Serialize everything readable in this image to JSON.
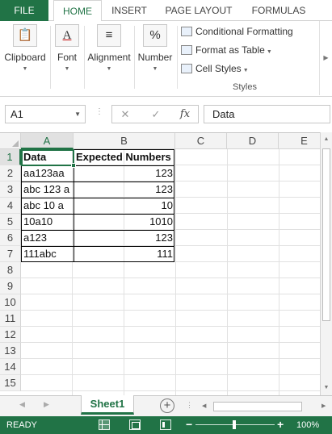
{
  "ribbon_tabs": {
    "file": "FILE",
    "home": "HOME",
    "insert": "INSERT",
    "page_layout": "PAGE LAYOUT",
    "formulas": "FORMULAS"
  },
  "ribbon": {
    "clipboard": "Clipboard",
    "font": "Font",
    "alignment": "Alignment",
    "number": "Number",
    "number_icon": "%",
    "font_icon": "A",
    "styles": {
      "conditional_formatting": "Conditional Formatting",
      "format_as_table": "Format as Table",
      "cell_styles": "Cell Styles",
      "group_label": "Styles"
    }
  },
  "formula_bar": {
    "name_box": "A1",
    "cancel_symbol": "✕",
    "enter_symbol": "✓",
    "fx_symbol": "fx",
    "content": "Data"
  },
  "grid": {
    "columns": [
      "A",
      "B",
      "C",
      "D",
      "E"
    ],
    "rows": [
      "1",
      "2",
      "3",
      "4",
      "5",
      "6",
      "7",
      "8",
      "9",
      "10",
      "11",
      "12",
      "13",
      "14",
      "15"
    ],
    "header": {
      "a": "Data",
      "b": "Expected Numbers"
    },
    "data": [
      {
        "a": "aa123aa",
        "b": "123"
      },
      {
        "a": "abc 123 a",
        "b": "123"
      },
      {
        "a": "abc 10 a",
        "b": "10"
      },
      {
        "a": "10a10",
        "b": "1010"
      },
      {
        "a": "a123",
        "b": "123"
      },
      {
        "a": "111abc",
        "b": "111"
      }
    ]
  },
  "sheet_tabs": {
    "active": "Sheet1",
    "add_symbol": "+"
  },
  "status_bar": {
    "status": "READY",
    "zoom_level": "100%",
    "zoom_minus": "−",
    "zoom_plus": "+"
  },
  "colors": {
    "accent": "#217346",
    "grid_line": "#e1e1e1",
    "header_bg": "#f3f3f3"
  }
}
